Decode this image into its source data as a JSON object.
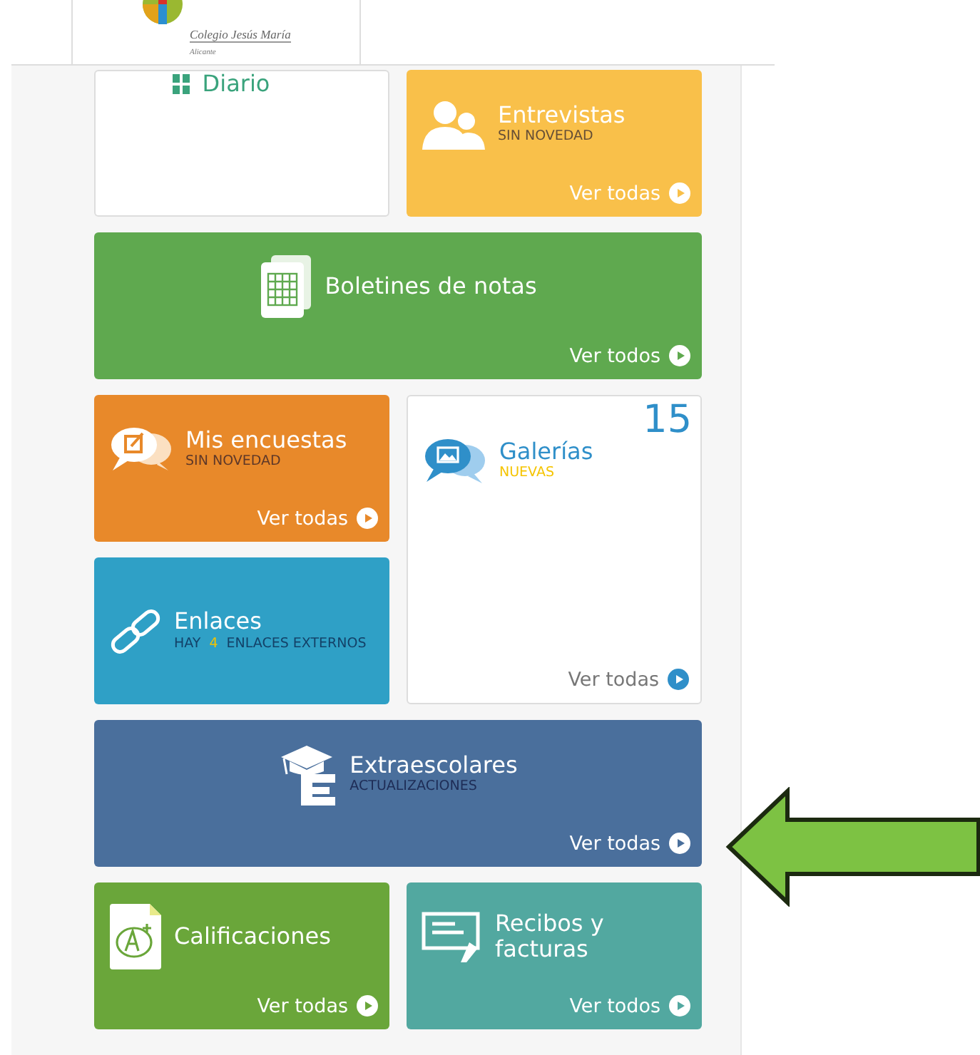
{
  "header": {
    "logo_name": "Colegio Jesús María",
    "logo_city": "Alicante"
  },
  "tiles": [
    {
      "kind": "small",
      "title": "Diario",
      "color": "#3aa37c",
      "filled": false
    },
    {
      "kind": "small",
      "title": "Entrevistas",
      "subtitle": [
        {
          "text": "SIN NOVEDAD",
          "highlight": false
        }
      ],
      "link": "Ver todas",
      "color": "#f9c04a",
      "filled": true
    },
    {
      "kind": "wide",
      "title": "Boletines de notas",
      "link": "Ver todos",
      "color": "#5fa94f",
      "filled": true
    },
    {
      "kind": "small",
      "title": "Mis encuestas",
      "subtitle": [
        {
          "text": "SIN NOVEDAD",
          "highlight": false
        }
      ],
      "link": "Ver todas",
      "color": "#e8892a",
      "filled": true
    },
    {
      "kind": "tall",
      "title": "Galerías",
      "subtitle": [
        {
          "text": "NUEVAS",
          "highlight": true
        }
      ],
      "count": "15",
      "link": "Ver todas",
      "color": "#2f8fc9",
      "filled": false
    },
    {
      "kind": "small",
      "title": "Enlaces",
      "subtitle": [
        {
          "text": "HAY",
          "highlight": false
        },
        {
          "text": "4",
          "highlight": true
        },
        {
          "text": "ENLACES EXTERNOS",
          "highlight": false
        }
      ],
      "color": "#2fa0c6",
      "filled": true
    },
    {
      "kind": "wide",
      "title": "Extraescolares",
      "subtitle": [
        {
          "text": "ACTUALIZACIONES",
          "highlight": false
        }
      ],
      "link": "Ver todas",
      "color": "#4a6f9c",
      "filled": true
    },
    {
      "kind": "small",
      "title": "Calificaciones",
      "link": "Ver todas",
      "color": "#6aa63a",
      "filled": true
    },
    {
      "kind": "small",
      "title": "Recibos y facturas",
      "link": "Ver todos",
      "color": "#52a8a0",
      "filled": true
    }
  ]
}
